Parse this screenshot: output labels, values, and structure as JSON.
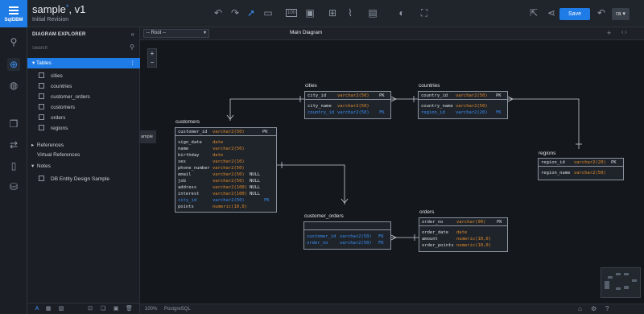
{
  "app": {
    "brand": "SqlDBM",
    "title": "sample",
    "version": ", v1",
    "revision": "Initial Revision"
  },
  "toolbar": {
    "save_label": "Save",
    "user_initials": "ra"
  },
  "explorer": {
    "heading": "DIAGRAM EXPLORER",
    "search_placeholder": "Search",
    "tables_label": "Tables",
    "tables": [
      "cities",
      "countries",
      "customer_orders",
      "customers",
      "orders",
      "regions"
    ],
    "groups": [
      "References",
      "Virtual References",
      "Notes"
    ],
    "notes": [
      "DB Entity Design Sample"
    ]
  },
  "tabs": {
    "root_select": "-- Root --",
    "main": "Main Diagram"
  },
  "canvas": {
    "sample_tag": "ample"
  },
  "status": {
    "zoom": "100%",
    "db": "PostgreSQL"
  },
  "entities": {
    "cities": {
      "name": "cities",
      "pk": [
        {
          "col": "city_id",
          "type": "varchar2(50)",
          "key": "PK"
        }
      ],
      "cols": [
        {
          "col": "city_name",
          "type": "varchar2(50)",
          "null": "",
          "key": "",
          "fk": false
        },
        {
          "col": "country_id",
          "type": "varchar2(50)",
          "null": "",
          "key": "FK",
          "fk": true
        }
      ]
    },
    "countries": {
      "name": "countries",
      "pk": [
        {
          "col": "country_id",
          "type": "varchar2(50)",
          "key": "PK"
        }
      ],
      "cols": [
        {
          "col": "country_name",
          "type": "varchar2(50)",
          "null": "",
          "key": "",
          "fk": false
        },
        {
          "col": "region_id",
          "type": "varchar2(20)",
          "null": "",
          "key": "FK",
          "fk": true
        }
      ]
    },
    "regions": {
      "name": "regions",
      "pk": [
        {
          "col": "region_id",
          "type": "varchar2(20)",
          "key": "PK"
        }
      ],
      "cols": [
        {
          "col": "region_name",
          "type": "varchar2(50)",
          "null": "",
          "key": "",
          "fk": false
        }
      ]
    },
    "customers": {
      "name": "customers",
      "pk": [
        {
          "col": "customer_id",
          "type": "varchar2(50)",
          "key": "PK"
        }
      ],
      "cols": [
        {
          "col": "sign_date",
          "type": "date",
          "null": "",
          "key": "",
          "fk": false
        },
        {
          "col": "name",
          "type": "varchar2(50)",
          "null": "",
          "key": "",
          "fk": false
        },
        {
          "col": "birthday",
          "type": "date",
          "null": "",
          "key": "",
          "fk": false
        },
        {
          "col": "sex",
          "type": "varchar2(10)",
          "null": "",
          "key": "",
          "fk": false
        },
        {
          "col": "phone_number",
          "type": "varchar2(50)",
          "null": "",
          "key": "",
          "fk": false
        },
        {
          "col": "email",
          "type": "varchar2(50)",
          "null": "NULL",
          "key": "",
          "fk": false
        },
        {
          "col": "job",
          "type": "varchar2(50)",
          "null": "NULL",
          "key": "",
          "fk": false
        },
        {
          "col": "address",
          "type": "varchar2(100)",
          "null": "NULL",
          "key": "",
          "fk": false
        },
        {
          "col": "interest",
          "type": "varchar2(100)",
          "null": "NULL",
          "key": "",
          "fk": false
        },
        {
          "col": "city_id",
          "type": "varchar2(50)",
          "null": "",
          "key": "FK",
          "fk": true
        },
        {
          "col": "points",
          "type": "numeric(10,0)",
          "null": "",
          "key": "",
          "fk": false
        }
      ]
    },
    "customer_orders": {
      "name": "customer_orders",
      "pk": [],
      "cols": [
        {
          "col": "customer_id",
          "type": "varchar2(50)",
          "null": "",
          "key": "FK",
          "fk": true
        },
        {
          "col": "order_no",
          "type": "varchar2(50)",
          "null": "",
          "key": "FK",
          "fk": true
        }
      ]
    },
    "orders": {
      "name": "orders",
      "pk": [
        {
          "col": "order_no",
          "type": "varchar(90)",
          "key": "PK"
        }
      ],
      "cols": [
        {
          "col": "order_date",
          "type": "date",
          "null": "",
          "key": "",
          "fk": false
        },
        {
          "col": "amount",
          "type": "numeric(10,0)",
          "null": "",
          "key": "",
          "fk": false
        },
        {
          "col": "order_points",
          "type": "numeric(10,0)",
          "null": "",
          "key": "",
          "fk": false
        }
      ]
    }
  }
}
